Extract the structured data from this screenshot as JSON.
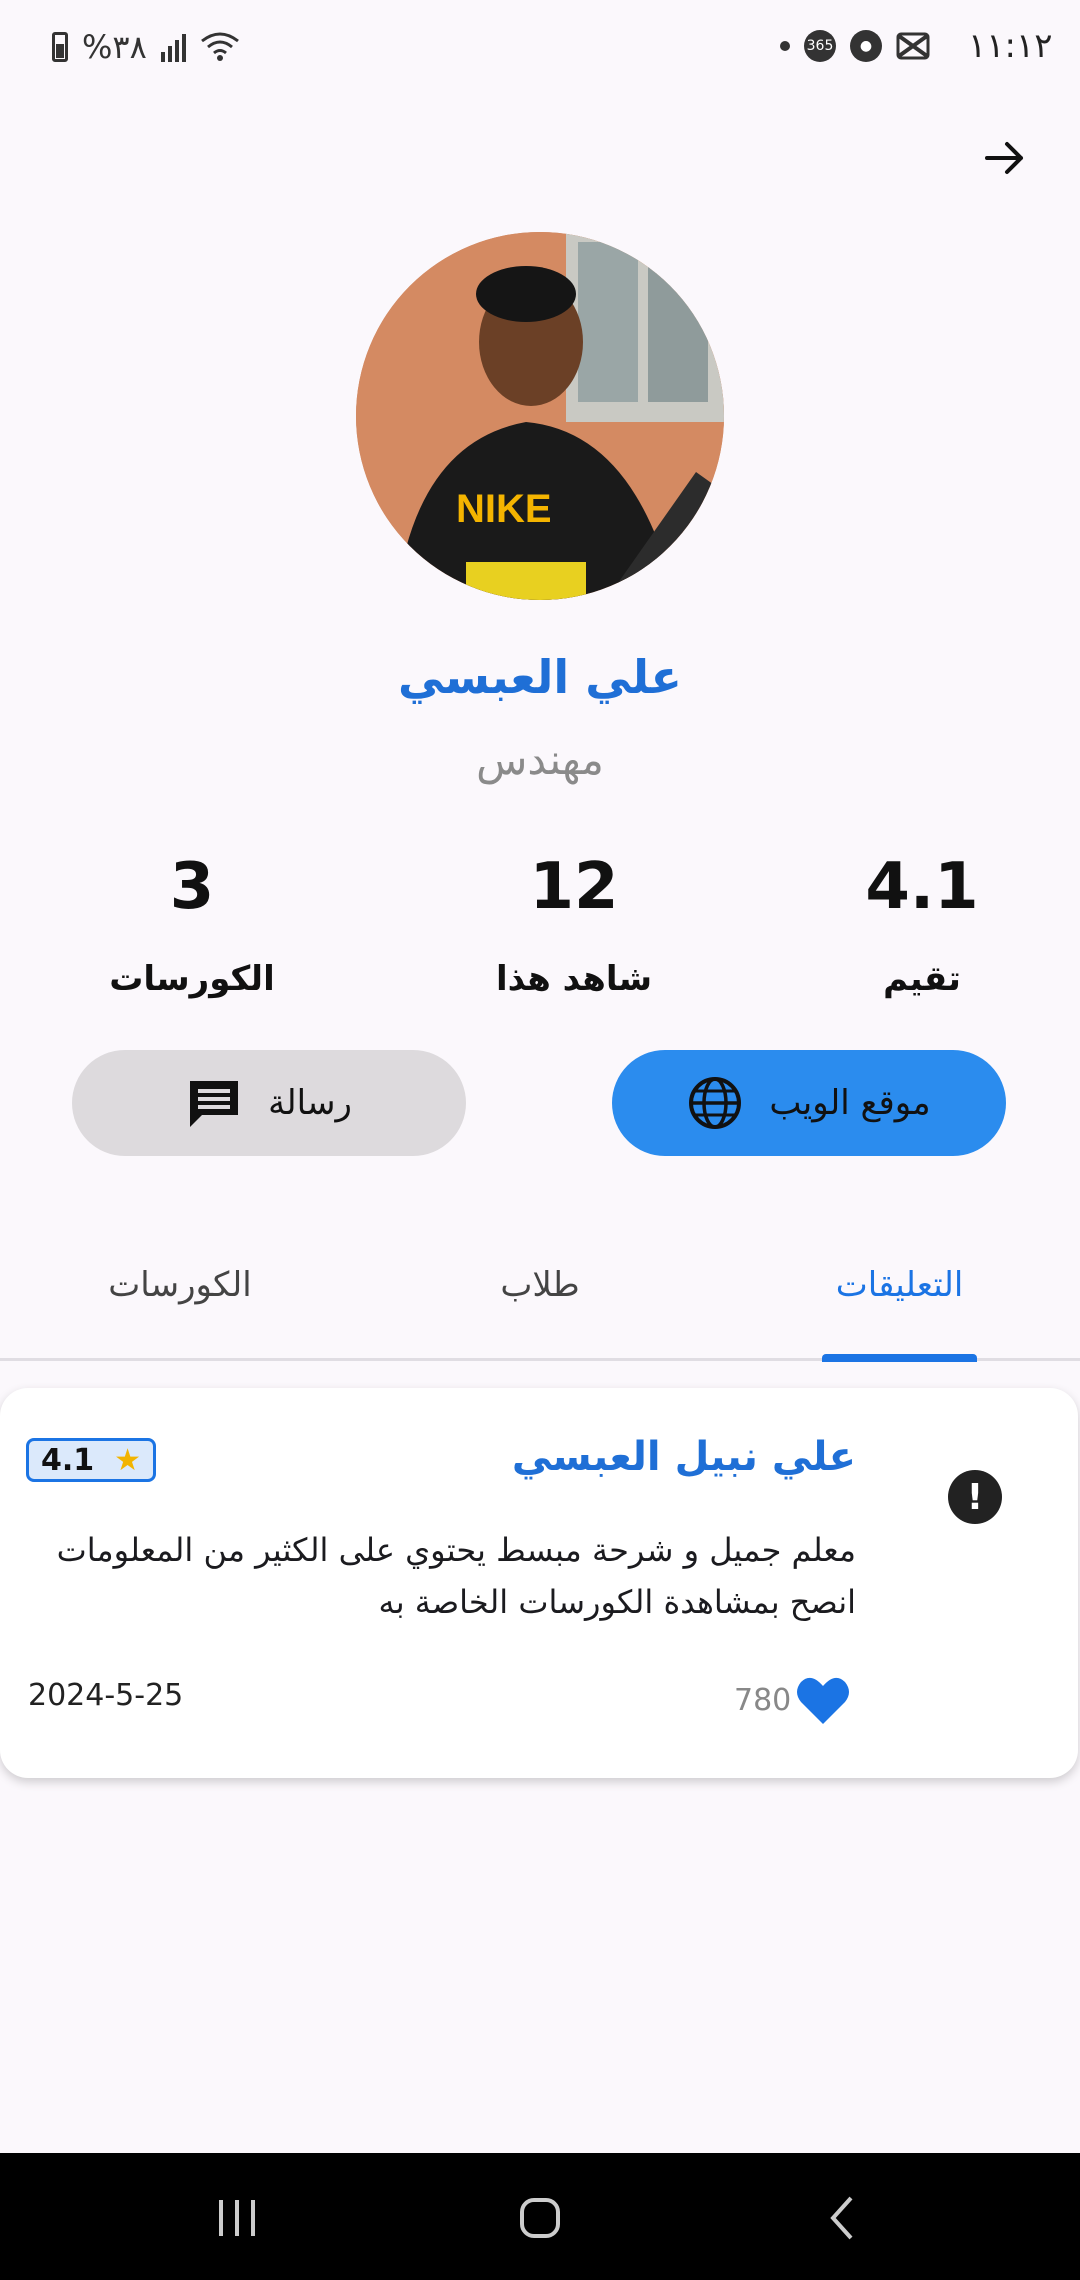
{
  "status_bar": {
    "time": "١١:١٢",
    "battery": "%٣٨"
  },
  "profile": {
    "name": "علي العبسي",
    "job_title": "مهندس"
  },
  "stats": [
    {
      "value": "4.1",
      "label": "تقيم"
    },
    {
      "value": "12",
      "label": "شاهد هذا"
    },
    {
      "value": "3",
      "label": "الكورسات"
    }
  ],
  "buttons": {
    "website_label": "موقع الويب",
    "message_label": "رسالة"
  },
  "tabs": [
    {
      "label": "التعليقات",
      "active": true
    },
    {
      "label": "طلاب",
      "active": false
    },
    {
      "label": "الكورسات",
      "active": false
    }
  ],
  "reviews": [
    {
      "reviewer": "علي نبيل العبسي",
      "rating": "4.1",
      "text": "معلم جميل و شرحة مبسط يحتوي على الكثير من المعلومات انصح بمشاهدة الكورسات الخاصة به",
      "likes": "780",
      "date": "2024-5-25"
    }
  ],
  "colors": {
    "accent": "#1b74e4",
    "website_button": "#2b8cee",
    "message_button": "#dddadd",
    "star": "#f2b400"
  },
  "icons": {
    "back": "arrow-right-icon",
    "website": "globe-icon",
    "message": "chat-icon",
    "report": "exclamation-icon",
    "like": "heart-icon"
  }
}
